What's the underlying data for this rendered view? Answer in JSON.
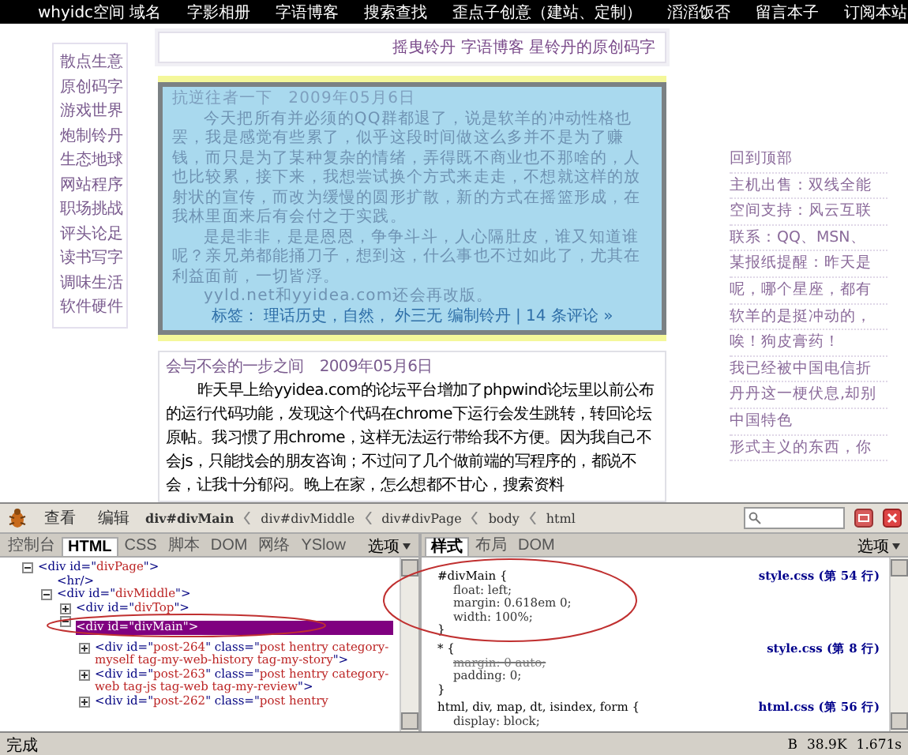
{
  "nav": {
    "items": [
      "whyidc空间 域名",
      "字影相册",
      "字语博客",
      "搜索查找",
      "歪点子创意（建站、定制）",
      "滔滔饭否",
      "留言本子",
      "订阅本站"
    ]
  },
  "header": {
    "title": "摇曳铃丹 字语博客 星铃丹的原创码字"
  },
  "categories": [
    "散点生意",
    "原创码字",
    "游戏世界",
    "炮制铃丹",
    "生态地球",
    "网站程序",
    "职场挑战",
    "评头论足",
    "读书写字",
    "调味生活",
    "软件硬件"
  ],
  "posts": [
    {
      "kind": "highlight",
      "title": "抗逆往者一下",
      "date": "2009年05月6日",
      "paragraphs": [
        "今天把所有并必须的QQ群都退了，说是软羊的冲动性格也罢，我是感觉有些累了，似乎这段时间做这么多并不是为了赚钱，而只是为了某种复杂的情绪，弄得既不商业也不那啥的，人也比较累，接下来，我想尝试换个方式来走走，不想就这样的放射状的宣传，而改为缓慢的圆形扩散，新的方式在摇篮形成，在我林里面来后有会付之于实践。",
        "是是非非，是是恩恩，争争斗斗，人心隔肚皮，谁又知道谁呢？亲兄弟都能捅刀子，想到这，什么事也不过如此了，尤其在利益面前，一切皆浮。",
        "yyld.net和yyidea.com还会再改版。"
      ],
      "footer": "标签： 理话历史，自然， 外三无 编制铃丹 | 14 条评论 »"
    },
    {
      "kind": "plain",
      "title": "会与不会的一步之间",
      "date": "2009年05月6日",
      "paragraphs": [
        "昨天早上给yyidea.com的论坛平台增加了phpwind论坛里以前公布的运行代码功能，发现这个代码在chrome下运行会发生跳转，转回论坛原帖。我习惯了用chrome，这样无法运行带给我不方便。因为我自己不会js，只能找会的朋友咨询；不过问了几个做前端的写程序的，都说不会，让我十分郁闷。晚上在家，怎么想都不甘心，搜索资料"
      ]
    }
  ],
  "sidebar": {
    "items": [
      "回到顶部",
      "主机出售：双线全能",
      "空间支持：风云互联",
      "联系：QQ、MSN、",
      "某报纸提醒：昨天是",
      "呢，哪个星座，都有",
      "软羊的是挺冲动的，",
      "唉！狗皮膏药！",
      "我已经被中国电信折",
      "丹丹这一梗伏息,却别",
      "中国特色",
      "形式主义的东西，你"
    ]
  },
  "firebug": {
    "menus": [
      "查看",
      "编辑"
    ],
    "breadcrumb": [
      {
        "label": "div#divMain",
        "selected": true
      },
      {
        "label": "div#divMiddle",
        "selected": false
      },
      {
        "label": "div#divPage",
        "selected": false
      },
      {
        "label": "body",
        "selected": false
      },
      {
        "label": "html",
        "selected": false
      }
    ],
    "html_tabs": [
      {
        "label": "控制台",
        "selected": false
      },
      {
        "label": "HTML",
        "selected": true
      },
      {
        "label": "CSS",
        "selected": false
      },
      {
        "label": "脚本",
        "selected": false
      },
      {
        "label": "DOM",
        "selected": false
      },
      {
        "label": "网络",
        "selected": false
      },
      {
        "label": "YSlow",
        "selected": false
      }
    ],
    "html_options": "选项",
    "tree": [
      {
        "kind": "node",
        "expanded": true,
        "selected": false,
        "parts": [
          {
            "kind": "tag",
            "text": "<div id=\""
          },
          {
            "kind": "value",
            "text": "divPage"
          },
          {
            "kind": "tag",
            "text": "\">"
          }
        ],
        "children": [
          {
            "kind": "leaf",
            "selected": false,
            "parts": [
              {
                "kind": "tag",
                "text": "<hr/>"
              }
            ]
          },
          {
            "kind": "node",
            "expanded": true,
            "selected": false,
            "parts": [
              {
                "kind": "tag",
                "text": "<div id=\""
              },
              {
                "kind": "value",
                "text": "divMiddle"
              },
              {
                "kind": "tag",
                "text": "\">"
              }
            ],
            "children": [
              {
                "kind": "node",
                "expanded": false,
                "selected": false,
                "parts": [
                  {
                    "kind": "tag",
                    "text": "<div id=\""
                  },
                  {
                    "kind": "value",
                    "text": "divTop"
                  },
                  {
                    "kind": "tag",
                    "text": "\">"
                  }
                ]
              },
              {
                "kind": "node",
                "expanded": true,
                "selected": true,
                "parts": [
                  {
                    "kind": "tag",
                    "text": "<div id=\""
                  },
                  {
                    "kind": "value",
                    "text": "divMain"
                  },
                  {
                    "kind": "tag",
                    "text": "\">"
                  }
                ],
                "children": [
                  {
                    "kind": "node",
                    "expanded": false,
                    "selected": false,
                    "parts": [
                      {
                        "kind": "tag",
                        "text": "<div id=\""
                      },
                      {
                        "kind": "value",
                        "text": "post-264"
                      },
                      {
                        "kind": "tag",
                        "text": "\" class=\""
                      },
                      {
                        "kind": "value",
                        "text": "post hentry category-myself tag-my-web-history tag-my-story"
                      },
                      {
                        "kind": "tag",
                        "text": "\">"
                      }
                    ]
                  },
                  {
                    "kind": "node",
                    "expanded": false,
                    "selected": false,
                    "parts": [
                      {
                        "kind": "tag",
                        "text": "<div id=\""
                      },
                      {
                        "kind": "value",
                        "text": "post-263"
                      },
                      {
                        "kind": "tag",
                        "text": "\" class=\""
                      },
                      {
                        "kind": "value",
                        "text": "post hentry category-web tag-js tag-web tag-my-review"
                      },
                      {
                        "kind": "tag",
                        "text": "\">"
                      }
                    ]
                  },
                  {
                    "kind": "node",
                    "expanded": false,
                    "selected": false,
                    "parts": [
                      {
                        "kind": "tag",
                        "text": "<div id=\""
                      },
                      {
                        "kind": "value",
                        "text": "post-262"
                      },
                      {
                        "kind": "tag",
                        "text": "\" class=\""
                      },
                      {
                        "kind": "value",
                        "text": "post hentry"
                      }
                    ]
                  }
                ]
              }
            ]
          }
        ]
      }
    ],
    "style_tabs": [
      {
        "label": "样式",
        "selected": true
      },
      {
        "label": "布局",
        "selected": false
      },
      {
        "label": "DOM",
        "selected": false
      }
    ],
    "style_options": "选项",
    "rules": [
      {
        "selector": "#divMain {",
        "source": "style.css (第 54 行)",
        "props": [
          {
            "text": "float: left;",
            "overridden": false
          },
          {
            "text": "margin: 0.618em 0;",
            "overridden": false
          },
          {
            "text": "width: 100%;",
            "overridden": false
          }
        ],
        "close": "}"
      },
      {
        "selector": "* {",
        "source": "style.css (第 8 行)",
        "props": [
          {
            "text": "margin: 0 auto;",
            "overridden": true
          },
          {
            "text": "padding: 0;",
            "overridden": false
          }
        ],
        "close": "}"
      },
      {
        "selector": "html, div, map, dt, isindex, form {",
        "source": "html.css (第 56 行)",
        "props": [
          {
            "text": "display: block;",
            "overridden": false
          }
        ]
      }
    ]
  },
  "status_bar": {
    "text": "完成",
    "stats": [
      "B",
      "38.9K",
      "1.671s"
    ]
  }
}
